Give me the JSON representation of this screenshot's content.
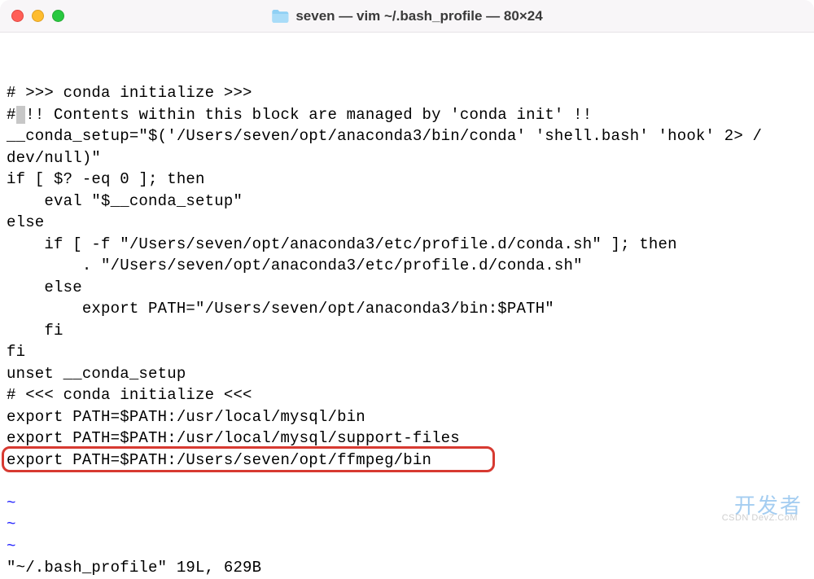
{
  "window": {
    "title": "seven — vim ~/.bash_profile — 80×24",
    "folder_icon": "folder-icon"
  },
  "editor": {
    "lines": [
      "",
      "# >>> conda initialize >>>",
      "# !! Contents within this block are managed by 'conda init' !!",
      "__conda_setup=\"$('/Users/seven/opt/anaconda3/bin/conda' 'shell.bash' 'hook' 2> /",
      "dev/null)\"",
      "if [ $? -eq 0 ]; then",
      "    eval \"$__conda_setup\"",
      "else",
      "    if [ -f \"/Users/seven/opt/anaconda3/etc/profile.d/conda.sh\" ]; then",
      "        . \"/Users/seven/opt/anaconda3/etc/profile.d/conda.sh\"",
      "    else",
      "        export PATH=\"/Users/seven/opt/anaconda3/bin:$PATH\"",
      "    fi",
      "fi",
      "unset __conda_setup",
      "# <<< conda initialize <<<",
      "export PATH=$PATH:/usr/local/mysql/bin",
      "export PATH=$PATH:/usr/local/mysql/support-files",
      "export PATH=$PATH:/Users/seven/opt/ffmpeg/bin"
    ],
    "cursor_line_index": 2,
    "cursor_col_after_prefix": "#",
    "cursor_rest": " !! Contents within this block are managed by 'conda init' !!",
    "highlighted_line_index": 18,
    "tilde_count": 3,
    "status": "\"~/.bash_profile\" 19L, 629B"
  },
  "watermark": {
    "main": "开发者",
    "sub": "CSDN   DevZ.CoM"
  },
  "colors": {
    "highlight_border": "#d73a31",
    "cursor_bg": "#c7c7c7",
    "tilde": "#1a1aff"
  }
}
